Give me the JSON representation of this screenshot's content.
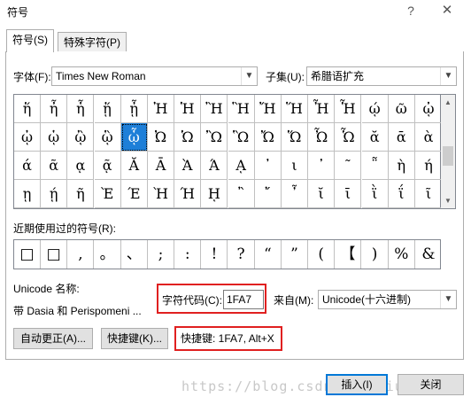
{
  "window": {
    "title": "符号",
    "help_label": "?",
    "close_label": "✕"
  },
  "tabs": [
    "符号(S)",
    "特殊字符(P)"
  ],
  "font": {
    "label": "字体(F):",
    "value": "Times New Roman"
  },
  "subset": {
    "label": "子集(U):",
    "value": "希腊语扩充"
  },
  "symbols": [
    [
      "ἥ",
      "ἦ",
      "ἧ",
      "ᾕ",
      "ᾖ",
      "Ἠ",
      "Ἡ",
      "Ἢ",
      "Ἣ",
      "Ἤ",
      "Ἥ",
      "Ἦ",
      "Ἧ",
      "ῴ",
      "ῶ",
      "ᾠ"
    ],
    [
      "ᾠ",
      "ᾡ",
      "ᾢ",
      "ᾣ",
      "ᾧ",
      "Ὠ",
      "Ὡ",
      "Ὢ",
      "Ὣ",
      "Ὤ",
      "Ὥ",
      "Ὦ",
      "Ὧ",
      "ᾰ",
      "ᾱ",
      "ὰ"
    ],
    [
      "ά",
      "ᾶ",
      "ᾳ",
      "ᾷ",
      "Ᾰ",
      "Ᾱ",
      "Ὰ",
      "Ά",
      "ᾼ",
      "᾽",
      "ι",
      "᾿",
      "῀",
      "῁",
      "ὴ",
      "ή"
    ],
    [
      "ῃ",
      "ῄ",
      "ῆ",
      "Ὲ",
      "Έ",
      "Ὴ",
      "Ή",
      "ῌ",
      "῍",
      "῎",
      "῏",
      "ῐ",
      "ῑ",
      "ῒ",
      "ΐ",
      "ῖ"
    ]
  ],
  "recent": {
    "label": "近期使用过的符号(R):",
    "symbols": [
      "□",
      "□",
      ",",
      "。",
      "、",
      ";",
      ":",
      "!",
      "?",
      "“",
      "”",
      "(",
      "【",
      ")",
      "%",
      "&"
    ]
  },
  "unicode_name": {
    "label": "Unicode 名称:",
    "value": "带 Dasia 和 Perispomeni ..."
  },
  "char_code": {
    "label": "字符代码(C):",
    "value": "1FA7"
  },
  "from": {
    "label": "来自(M):",
    "value": "Unicode(十六进制)"
  },
  "buttons": {
    "autocorrect": "自动更正(A)...",
    "shortcut_key": "快捷键(K)...",
    "insert": "插入(I)",
    "close": "关闭"
  },
  "shortcut_text": "快捷键: 1FA7, Alt+X",
  "watermark": "https://blog.csdn.net/liuyanfan",
  "selected": {
    "row": 1,
    "col": 4
  },
  "colors": {
    "selection": "#1e7fd8",
    "highlight_box": "#e02020",
    "default_button": "#0078d7"
  }
}
